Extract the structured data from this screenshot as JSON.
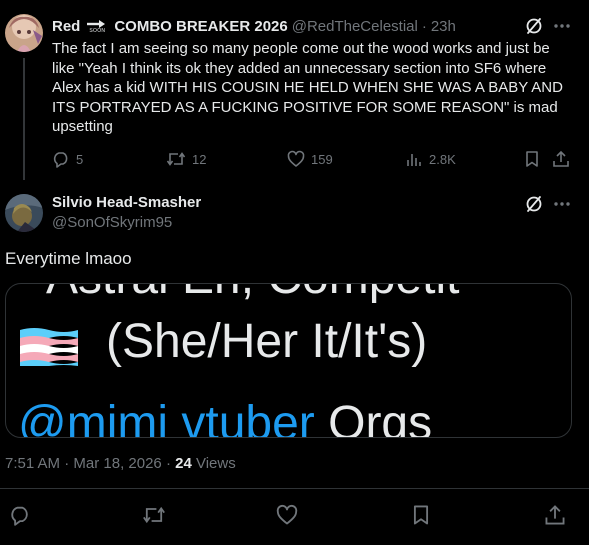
{
  "reply": {
    "display_name": "Red",
    "soon_badge": "SOON",
    "display_name_suffix": "COMBO BREAKER 2026",
    "handle": "@RedTheCelestial",
    "separator": "·",
    "time": "23h",
    "text": "The fact I am seeing so many people come out the wood works and just be like \"Yeah I think its ok they added an unnecessary section into SF6 where Alex has a kid WITH HIS COUSIN HE HELD WHEN SHE WAS A BABY AND ITS PORTRAYED AS A FUCKING POSITIVE FOR SOME REASON\" is mad upsetting",
    "actions": {
      "replies": "5",
      "reposts": "12",
      "likes": "159",
      "views": "2.8K"
    }
  },
  "main": {
    "display_name": "Silvio Head-Smasher",
    "handle": "@SonOfSkyrim95",
    "text": "Everytime lmaoo",
    "media": {
      "top_text": "Astral Eri, Competit",
      "pronouns": "(She/Her It/It's)",
      "mention": "@mimi vtuber",
      "mention_suffix": "Orgs"
    },
    "meta_time": "7:51 AM",
    "meta_separator": "·",
    "meta_date": "Mar 18, 2026",
    "meta_dot": "·",
    "views_count": "24",
    "views_label": "Views"
  },
  "icons": {
    "reply": "reply-icon",
    "repost": "repost-icon",
    "like": "heart-icon",
    "views": "views-icon",
    "bookmark": "bookmark-icon",
    "share": "share-icon",
    "grok": "grok-icon",
    "more": "more-icon"
  },
  "colors": {
    "background": "#000000",
    "text": "#e7e9ea",
    "muted": "#71767b",
    "border": "#2f3336",
    "link": "#1d9bf0",
    "trans_blue": "#5bcefa",
    "trans_pink": "#f5a9b8"
  }
}
